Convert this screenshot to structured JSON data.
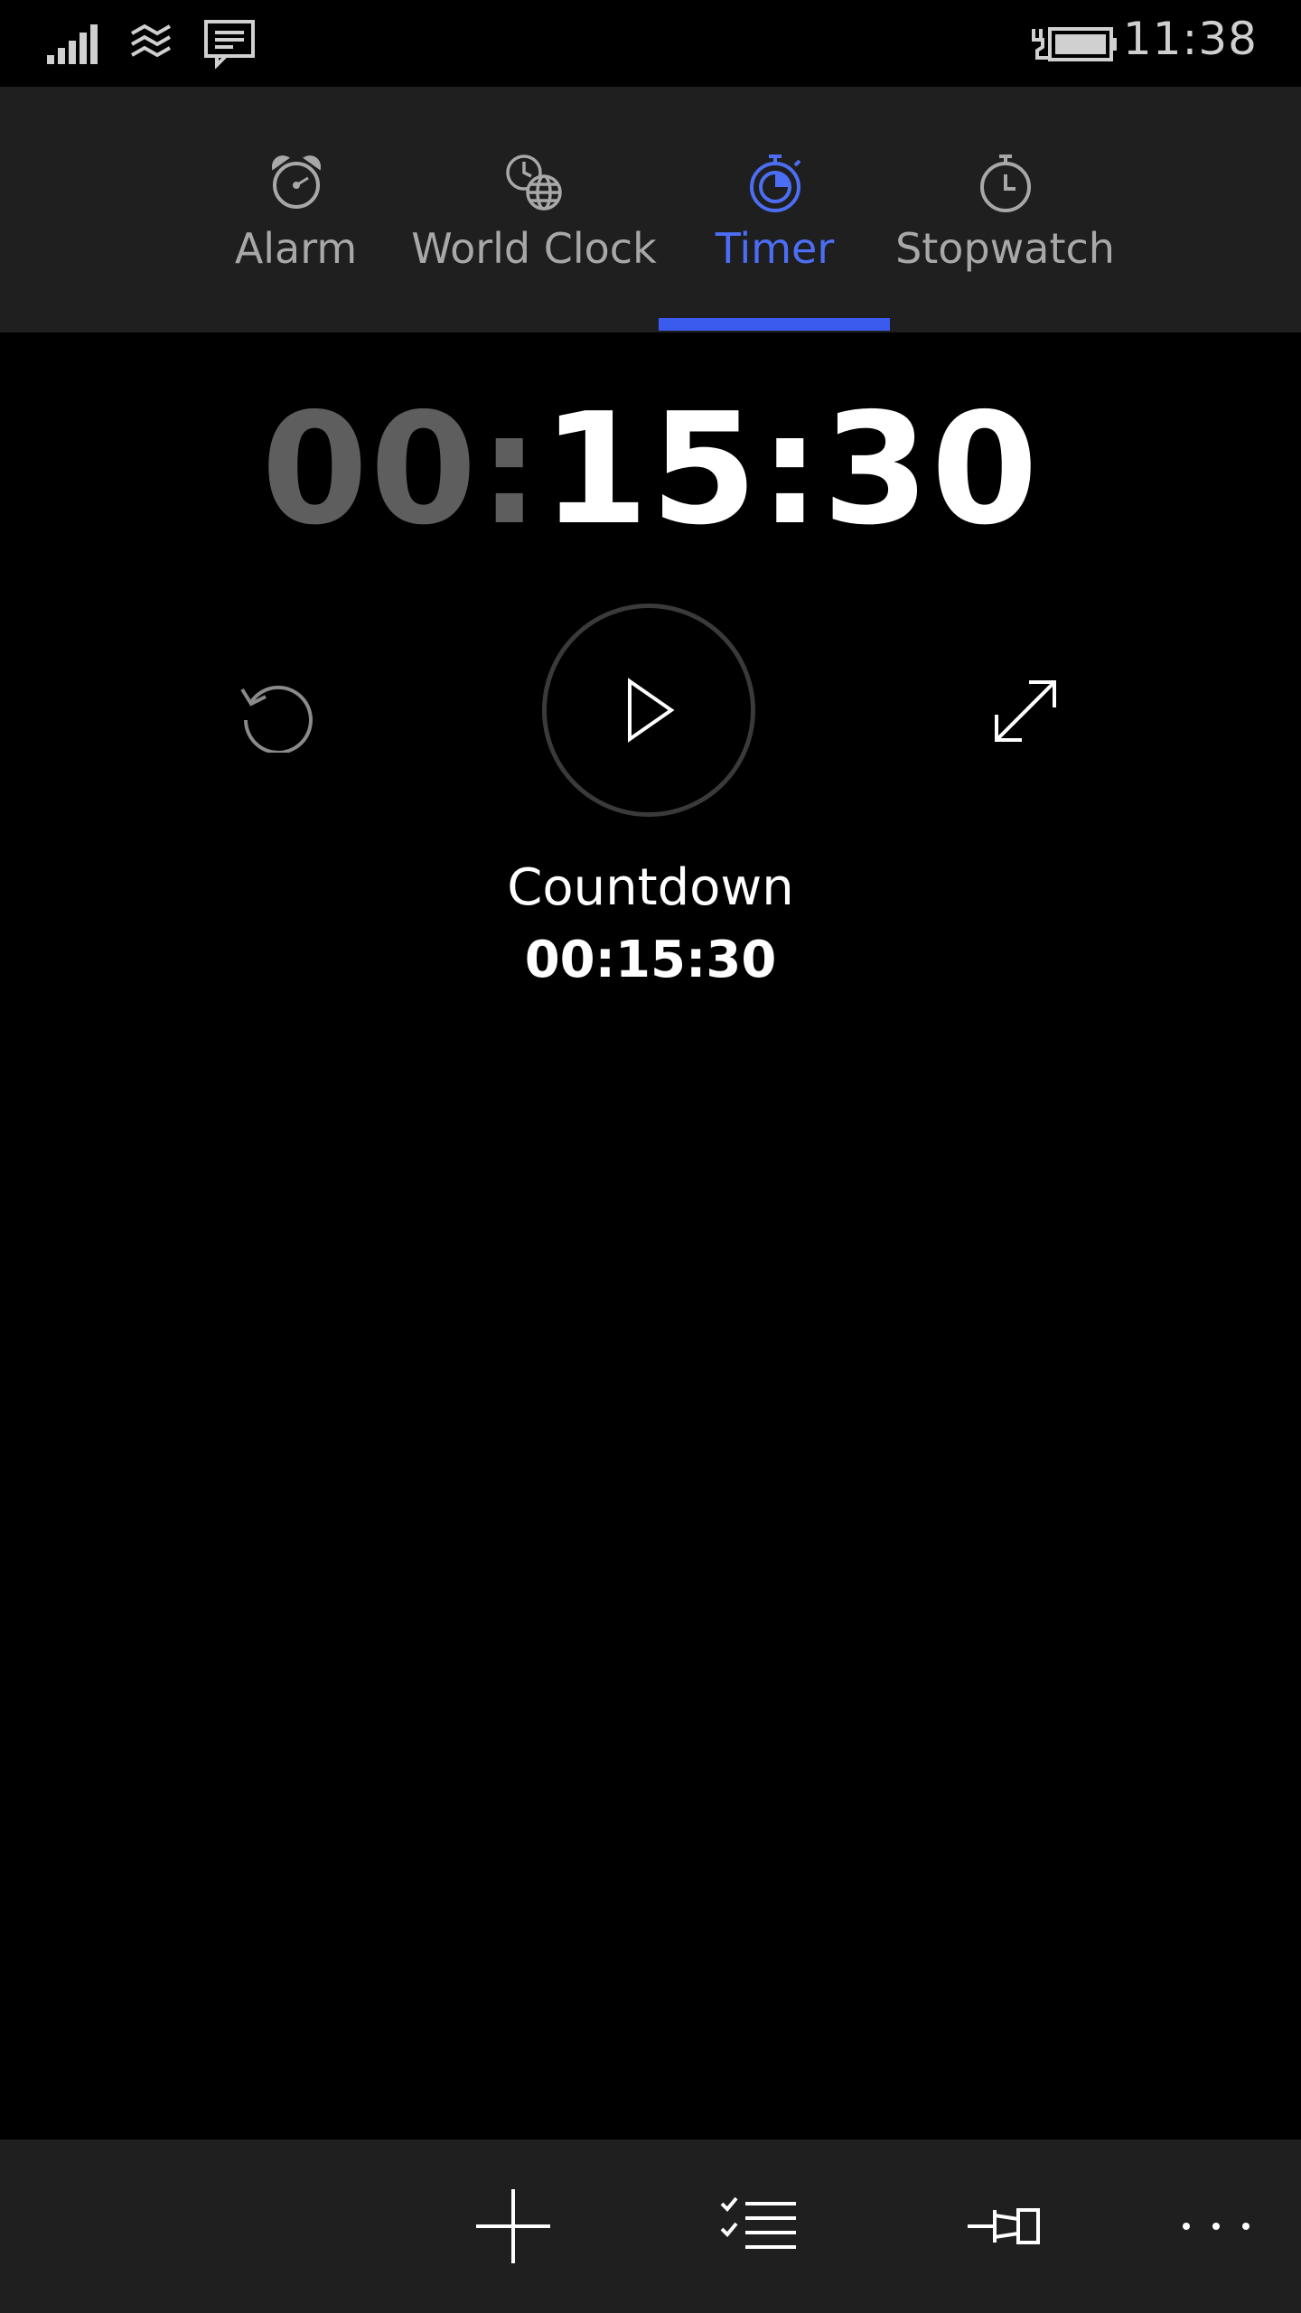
{
  "status_bar": {
    "time": "11:38",
    "icons": [
      "signal-icon",
      "wifi-icon",
      "message-icon",
      "battery-charging-icon"
    ]
  },
  "tabs": [
    {
      "label": "Alarm",
      "icon": "alarm-clock-icon",
      "active": false
    },
    {
      "label": "World Clock",
      "icon": "world-clock-icon",
      "active": false
    },
    {
      "label": "Timer",
      "icon": "timer-icon",
      "active": true
    },
    {
      "label": "Stopwatch",
      "icon": "stopwatch-icon",
      "active": false
    }
  ],
  "timer": {
    "hours": "00",
    "sep1": ":",
    "minutes": "15",
    "sep2": ":",
    "seconds": "30",
    "name": "Countdown",
    "duration": "00:15:30"
  },
  "controls": {
    "reset": "reset-icon",
    "play": "play-icon",
    "expand": "expand-icon"
  },
  "app_bar": {
    "buttons": [
      "add-icon",
      "select-list-icon",
      "pin-icon",
      "more-icon"
    ]
  },
  "colors": {
    "accent": "#3b5bef",
    "background": "#000000",
    "bar_background": "#1f1f1f",
    "dim_digits": "#5e5e5e"
  }
}
